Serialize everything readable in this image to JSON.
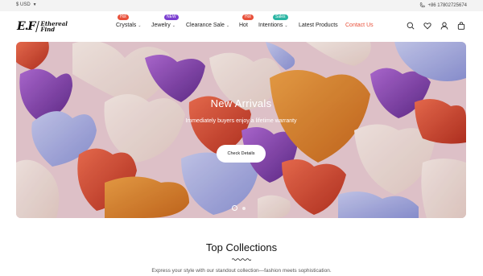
{
  "topbar": {
    "currency": "$ USD",
    "phone": "+86 17802725674"
  },
  "logo": {
    "mark": "E.F",
    "line1": "Ethereal",
    "line2": "Find"
  },
  "nav": {
    "items": [
      {
        "label": "Crystals",
        "has_dropdown": true,
        "badge": "Hot",
        "badge_color": "#e8503a"
      },
      {
        "label": "Jewelry",
        "has_dropdown": true,
        "badge": "NEW",
        "badge_color": "#7b3fd0"
      },
      {
        "label": "Clearance Sale",
        "has_dropdown": true
      },
      {
        "label": "Hot",
        "badge": "Hot",
        "badge_color": "#e8503a"
      },
      {
        "label": "Intentions",
        "has_dropdown": true,
        "badge": "Sales",
        "badge_color": "#2bb5a3"
      },
      {
        "label": "Latest Products"
      },
      {
        "label": "Contact Us",
        "color": "#e8503a"
      }
    ]
  },
  "header_icons": [
    "search-icon",
    "heart-icon",
    "user-icon",
    "bag-icon"
  ],
  "hero": {
    "title": "New Arrivals",
    "subtitle": "Immediately buyers enjoy a lifetime warranty",
    "button": "Check Details",
    "slide_count": 2,
    "active_slide": 1
  },
  "collections": {
    "title": "Top Collections",
    "subtitle": "Express your style with our standout collection—fashion meets sophistication."
  },
  "colors": {
    "accent": "#e8503a",
    "topbar_bg": "#f3f3f3",
    "hero_bg": "#e9c9d1"
  }
}
